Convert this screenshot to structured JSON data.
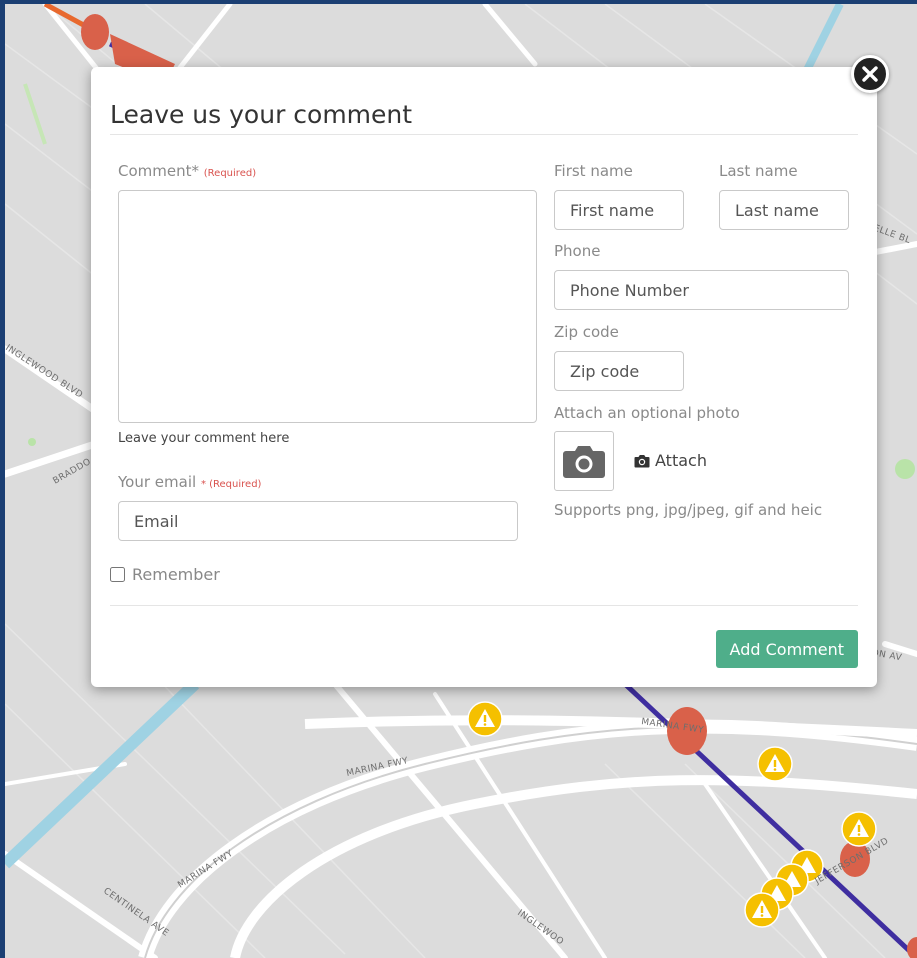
{
  "modal": {
    "title": "Leave us your comment",
    "comment_label": "Comment*",
    "required_tag": "(Required)",
    "comment_help": "Leave your comment here",
    "email_label": "Your email",
    "email_required_tag": "* (Required)",
    "email_placeholder": "Email",
    "first_name_label": "First name",
    "first_name_placeholder": "First name",
    "last_name_label": "Last name",
    "last_name_placeholder": "Last name",
    "phone_label": "Phone",
    "phone_placeholder": "Phone Number",
    "zip_label": "Zip code",
    "zip_placeholder": "Zip code",
    "photo_label": "Attach an optional photo",
    "attach_label": "Attach",
    "supports_text": "Supports png, jpg/jpeg, gif and heic",
    "remember_label": "Remember",
    "submit_label": "Add Comment"
  },
  "map": {
    "road_labels": [
      "INGLEWOOD BLVD",
      "BRADDO",
      "MARINA FWY",
      "MARINA FWY",
      "CENTINELA AVE",
      "INGLEWOO",
      "MARINA FWY",
      "JEFFERSON BLVD",
      "ELLE BL",
      "SON AV"
    ]
  },
  "colors": {
    "accent": "#4fae8a",
    "required": "#d9534f",
    "warning_marker": "#f5c000",
    "transit_line": "#3f2ea0",
    "hotspot": "#d9614a"
  }
}
